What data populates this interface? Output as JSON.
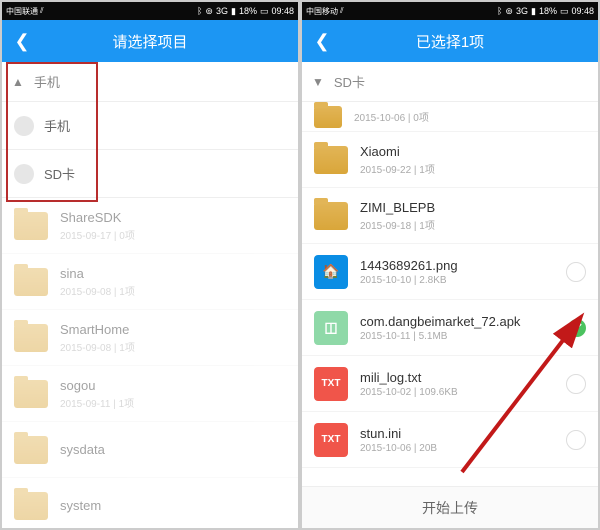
{
  "statusbar": {
    "carrier1": "中国联通",
    "carrier2": "中国移动",
    "net": "3G",
    "battery": "18%",
    "time": "09:48"
  },
  "left": {
    "title": "请选择项目",
    "crumb_label": "手机",
    "dropdown": {
      "opt1": "手机",
      "opt2": "SD卡"
    },
    "items": [
      {
        "name": "ShareSDK",
        "sub": "2015-09-17 | 0项"
      },
      {
        "name": "sina",
        "sub": "2015-09-08 | 1项"
      },
      {
        "name": "SmartHome",
        "sub": "2015-09-08 | 1项"
      },
      {
        "name": "sogou",
        "sub": "2015-09-11 | 1项"
      },
      {
        "name": "sysdata",
        "sub": ""
      },
      {
        "name": "system",
        "sub": ""
      }
    ]
  },
  "right": {
    "title": "已选择1项",
    "crumb_label": "SD卡",
    "items": [
      {
        "name": "",
        "sub": "2015-10-06 | 0项",
        "type": "folder"
      },
      {
        "name": "Xiaomi",
        "sub": "2015-09-22 | 1项",
        "type": "folder"
      },
      {
        "name": "ZIMI_BLEPB",
        "sub": "2015-09-18 | 1项",
        "type": "folder"
      },
      {
        "name": "1443689261.png",
        "sub": "2015-10-10 | 2.8KB",
        "type": "png"
      },
      {
        "name": "com.dangbeimarket_72.apk",
        "sub": "2015-10-11 | 5.1MB",
        "type": "apk",
        "selected": true
      },
      {
        "name": "mili_log.txt",
        "sub": "2015-10-02 | 109.6KB",
        "type": "txt"
      },
      {
        "name": "stun.ini",
        "sub": "2015-10-06 | 20B",
        "type": "txt"
      }
    ],
    "footer": "开始上传"
  }
}
